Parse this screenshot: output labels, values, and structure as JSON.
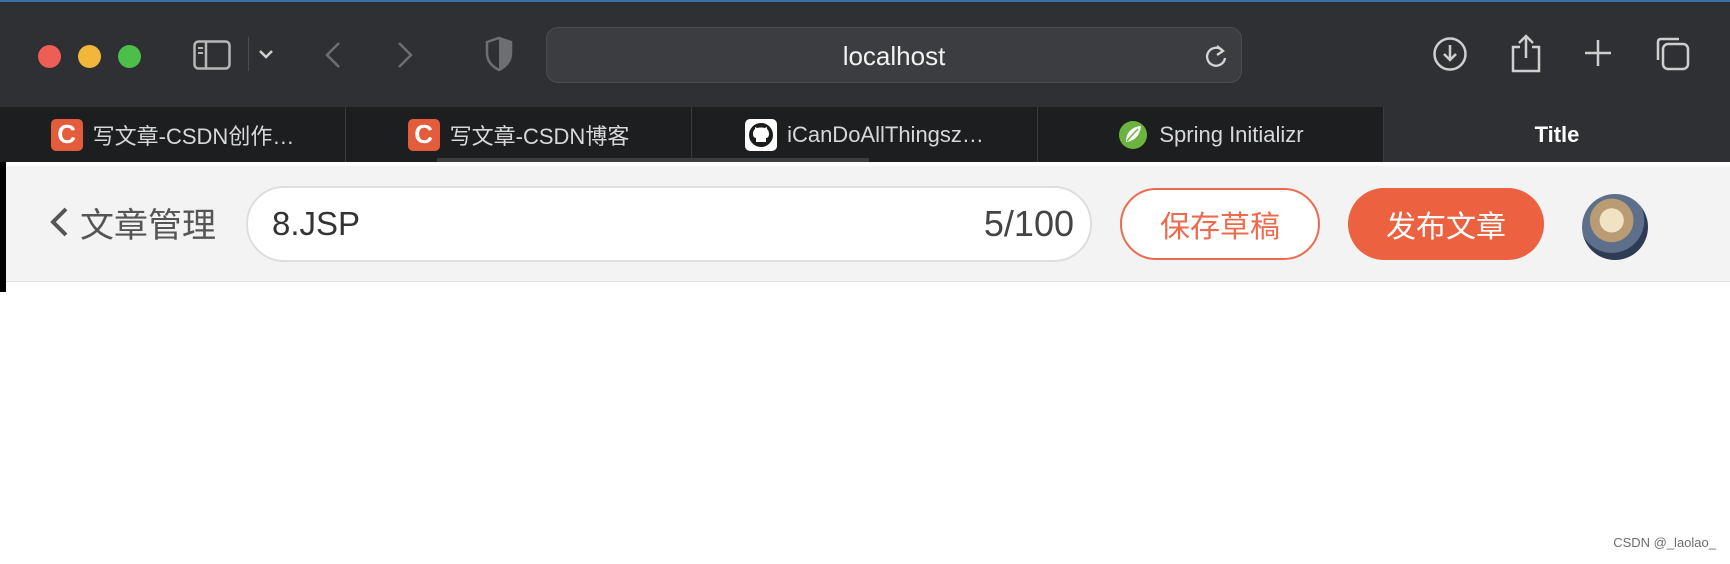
{
  "browser": {
    "url": "localhost",
    "tabs": [
      {
        "label": "写文章-CSDN创作…",
        "favicon": "csdn-icon"
      },
      {
        "label": "写文章-CSDN博客",
        "favicon": "csdn-icon"
      },
      {
        "label": "iCanDoAllThingsz…",
        "favicon": "github-icon"
      },
      {
        "label": "Spring Initializr",
        "favicon": "spring-icon"
      },
      {
        "label": "Title",
        "active": true
      }
    ],
    "csdn_favicon_letter": "C"
  },
  "editor": {
    "back_label": "文章管理",
    "title_value": "8.JSP",
    "title_counter": "5/100",
    "save_draft_label": "保存草稿",
    "publish_label": "发布文章"
  },
  "watermark": "CSDN @_laolao_",
  "colors": {
    "accent": "#ec6240",
    "toolbar": "#2e3033",
    "tabbar": "#1d1e20"
  }
}
